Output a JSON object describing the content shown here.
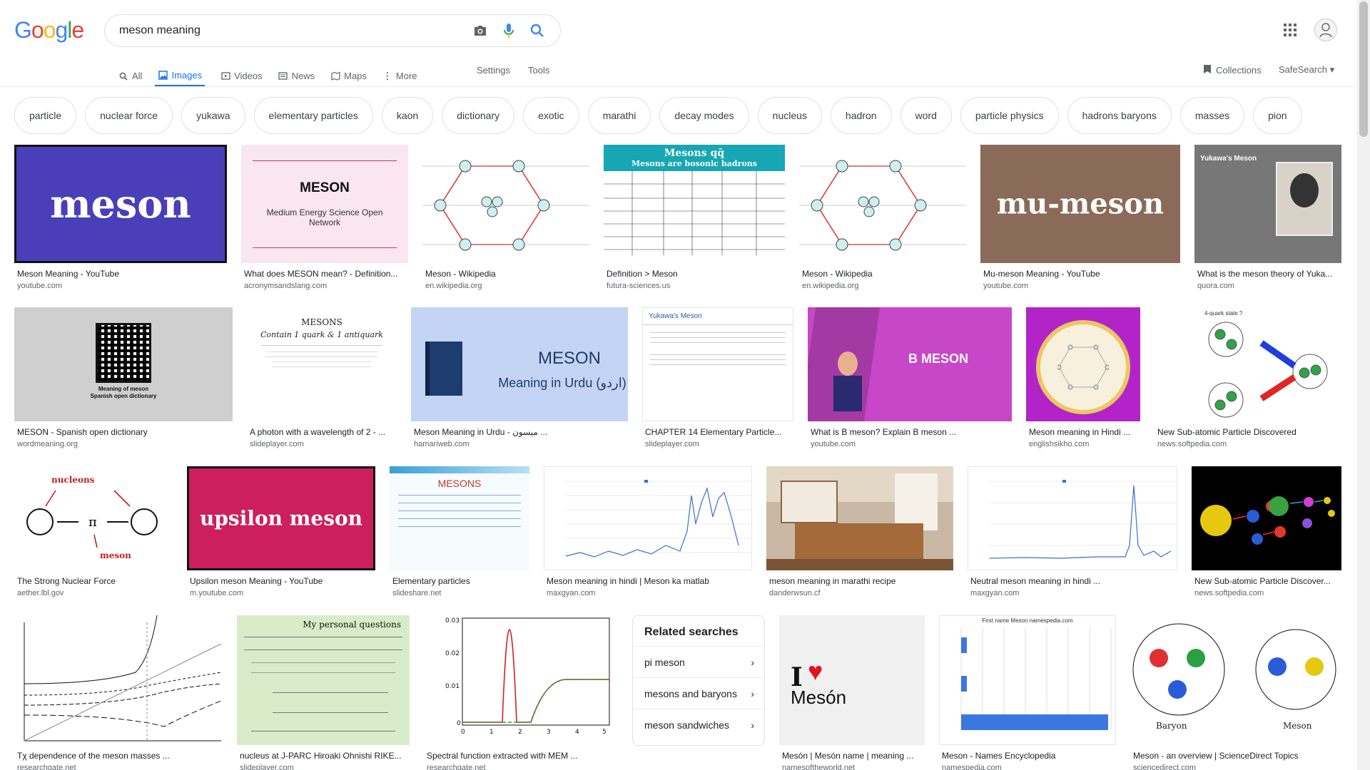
{
  "search": {
    "query": "meson meaning"
  },
  "logo": [
    "G",
    "o",
    "o",
    "g",
    "l",
    "e"
  ],
  "tabs": [
    {
      "label": "All",
      "icon": "search-icon"
    },
    {
      "label": "Images",
      "icon": "image-icon",
      "active": true
    },
    {
      "label": "Videos",
      "icon": "video-icon"
    },
    {
      "label": "News",
      "icon": "news-icon"
    },
    {
      "label": "Maps",
      "icon": "map-icon"
    },
    {
      "label": "More",
      "icon": "more-icon"
    }
  ],
  "toolbar": {
    "settings": "Settings",
    "tools": "Tools",
    "collections": "Collections",
    "safesearch": "SafeSearch"
  },
  "chips": [
    "particle",
    "nuclear force",
    "yukawa",
    "elementary particles",
    "kaon",
    "dictionary",
    "exotic",
    "marathi",
    "decay modes",
    "nucleus",
    "hadron",
    "word",
    "particle physics",
    "hadrons baryons",
    "masses",
    "pion"
  ],
  "results": [
    {
      "title": "Meson Meaning - YouTube",
      "source": "youtube.com",
      "thumb_text": "meson"
    },
    {
      "title": "What does MESON mean? - Definition...",
      "source": "acronymsandslang.com",
      "thumb_text": "MESON",
      "thumb_sub": "Medium Energy Science Open Network"
    },
    {
      "title": "Meson - Wikipedia",
      "source": "en.wikipedia.org"
    },
    {
      "title": "Definition > Meson",
      "source": "futura-sciences.us",
      "thumb_text": "Mesons qq̄",
      "thumb_sub": "Mesons are bosonic hadrons"
    },
    {
      "title": "Meson - Wikipedia",
      "source": "en.wikipedia.org"
    },
    {
      "title": "Mu-meson Meaning - YouTube",
      "source": "youtube.com",
      "thumb_text": "mu-meson"
    },
    {
      "title": "What is the meson theory of Yuka...",
      "source": "quora.com",
      "thumb_text": "Yukawa's Meson"
    },
    {
      "title": "MESON - Spanish open dictionary",
      "source": "wordmeaning.org",
      "thumb_text": "Meaning of meson",
      "thumb_sub": "Spanish open dictionary"
    },
    {
      "title": "A photon with a wavelength of 2 - ...",
      "source": "slideplayer.com",
      "thumb_text": "MESONS",
      "thumb_sub": "Contain 1 quark & 1 antiquark"
    },
    {
      "title": "Meson Meaning in Urdu - میسون ...",
      "source": "hamariweb.com",
      "thumb_text": "MESON",
      "thumb_sub": "Meaning in Urdu (اردو)"
    },
    {
      "title": "CHAPTER 14 Elementary Particle...",
      "source": "slideplayer.com",
      "thumb_text": "Yukawa's Meson"
    },
    {
      "title": "What is B meson? Explain B meson ...",
      "source": "youtube.com",
      "thumb_text": "B MESON"
    },
    {
      "title": "Meson meaning in Hindi ...",
      "source": "englishsikho.com"
    },
    {
      "title": "New Sub-atomic Particle Discovered",
      "source": "news.softpedia.com",
      "thumb_text": "4-quark state ?"
    },
    {
      "title": "The Strong Nuclear Force",
      "source": "aether.lbl.gov",
      "thumb_text": "nucleons",
      "thumb_sub": "meson"
    },
    {
      "title": "Upsilon meson Meaning - YouTube",
      "source": "m.youtube.com",
      "thumb_text": "upsilon meson"
    },
    {
      "title": "Elementary particles",
      "source": "slideshare.net",
      "thumb_text": "MESONS"
    },
    {
      "title": "Meson meaning in hindi | Meson ka matlab",
      "source": "maxgyan.com"
    },
    {
      "title": "meson meaning in marathi recipe",
      "source": "danderwsun.cf"
    },
    {
      "title": "Neutral meson meaning in hindi ...",
      "source": "maxgyan.com"
    },
    {
      "title": "New Sub-atomic Particle Discover...",
      "source": "news.softpedia.com"
    },
    {
      "title": "Tχ dependence of the meson masses ...",
      "source": "researchgate.net"
    },
    {
      "title": "nucleus at J-PARC Hiroaki Ohnishi RIKE...",
      "source": "slideplayer.com",
      "thumb_text": "My personal questions"
    },
    {
      "title": "Spectral function extracted with MEM ...",
      "source": "researchgate.net"
    },
    {
      "title": "Mesón | Mesón name | meaning ...",
      "source": "namesoftheworld.net",
      "thumb_text": "Mesón"
    },
    {
      "title": "Meson - Names Encyclopedia",
      "source": "namespedia.com",
      "thumb_text": "First name Meson namespedia.com"
    },
    {
      "title": "Meson - an overview | ScienceDirect Topics",
      "source": "sciencedirect.com",
      "thumb_text": "Baryon",
      "thumb_sub": "Meson"
    }
  ],
  "related": {
    "title": "Related searches",
    "items": [
      "pi meson",
      "mesons and baryons",
      "meson sandwiches"
    ]
  },
  "colors": {
    "accent": "#1a73e8",
    "meson_bg": "#4a3fb8",
    "mumeson_bg": "#8a6a58",
    "upsilon_bg": "#cc1f5b",
    "bmeson_bg": "#cc44cc",
    "hindi_bg": "#b324c8"
  }
}
